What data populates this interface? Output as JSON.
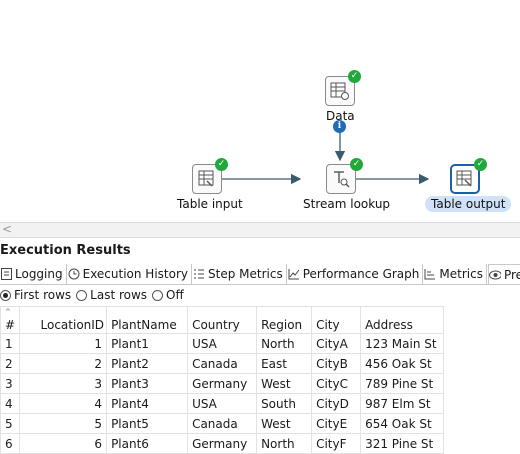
{
  "steps": {
    "data": {
      "label": "Data",
      "icon": "table-data-icon"
    },
    "table_input": {
      "label": "Table input",
      "icon": "table-input-icon"
    },
    "stream_lookup": {
      "label": "Stream lookup",
      "icon": "stream-lookup-icon"
    },
    "table_output": {
      "label": "Table output",
      "icon": "table-output-icon"
    }
  },
  "colors": {
    "check": "#20a83a",
    "info": "#1f6bb5",
    "selected": "#1f5fa8",
    "hop": "#3c5a6e"
  },
  "scroll": {
    "left_arrow": "<"
  },
  "results": {
    "title": "Execution Results",
    "tabs": [
      {
        "label": "Logging",
        "icon": "logging-icon"
      },
      {
        "label": "Execution History",
        "icon": "history-icon"
      },
      {
        "label": "Step Metrics",
        "icon": "step-metrics-icon"
      },
      {
        "label": "Performance Graph",
        "icon": "performance-graph-icon"
      },
      {
        "label": "Metrics",
        "icon": "metrics-icon"
      },
      {
        "label": "Preview data",
        "icon": "preview-eye-icon"
      }
    ],
    "radios": [
      {
        "label": "First rows",
        "selected": true
      },
      {
        "label": "Last rows",
        "selected": false
      },
      {
        "label": "Off",
        "selected": false
      }
    ]
  },
  "table": {
    "columns": [
      "#",
      "LocationID",
      "PlantName",
      "Country",
      "Region",
      "City",
      "Address"
    ],
    "rows": [
      [
        "1",
        "1",
        "Plant1",
        "USA",
        "North",
        "CityA",
        "123 Main St"
      ],
      [
        "2",
        "2",
        "Plant2",
        "Canada",
        "East",
        "CityB",
        "456 Oak St"
      ],
      [
        "3",
        "3",
        "Plant3",
        "Germany",
        "West",
        "CityC",
        "789 Pine St"
      ],
      [
        "4",
        "4",
        "Plant4",
        "USA",
        "South",
        "CityD",
        "987 Elm St"
      ],
      [
        "5",
        "5",
        "Plant5",
        "Canada",
        "West",
        "CityE",
        "654 Oak St"
      ],
      [
        "6",
        "6",
        "Plant6",
        "Germany",
        "North",
        "CityF",
        "321 Pine St"
      ]
    ]
  }
}
